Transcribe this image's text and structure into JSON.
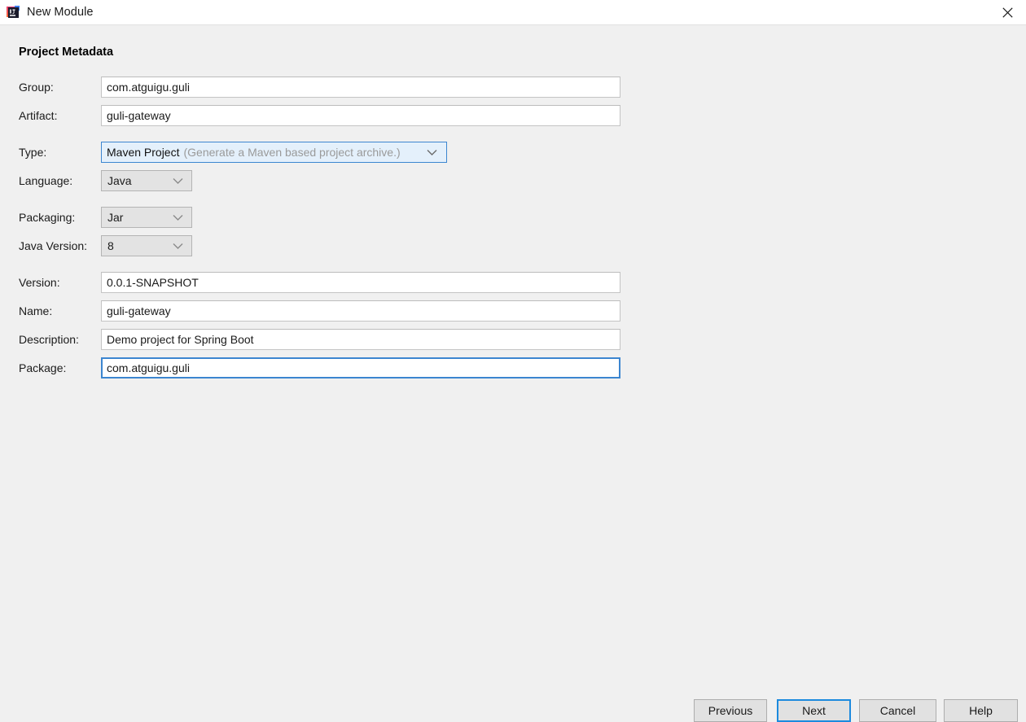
{
  "window": {
    "title": "New Module",
    "icon": "intellij-idea-icon",
    "close_label": "close-icon"
  },
  "section": {
    "title": "Project Metadata"
  },
  "fields": {
    "group": {
      "label": "Group:",
      "value": "com.atguigu.guli"
    },
    "artifact": {
      "label": "Artifact:",
      "value": "guli-gateway"
    },
    "type": {
      "label": "Type:",
      "value": "Maven Project",
      "hint": "(Generate a Maven based project archive.)"
    },
    "language": {
      "label": "Language:",
      "value": "Java"
    },
    "packaging": {
      "label": "Packaging:",
      "value": "Jar"
    },
    "java_version": {
      "label": "Java Version:",
      "value": "8"
    },
    "version": {
      "label": "Version:",
      "value": "0.0.1-SNAPSHOT"
    },
    "name": {
      "label": "Name:",
      "value": "guli-gateway"
    },
    "description": {
      "label": "Description:",
      "value": "Demo project for Spring Boot"
    },
    "package": {
      "label": "Package:",
      "value": "com.atguigu.guli"
    }
  },
  "buttons": {
    "previous": "Previous",
    "next": "Next",
    "cancel": "Cancel",
    "help": "Help"
  },
  "colors": {
    "focus_blue": "#1c8ade",
    "combo_focus_border": "#3c86d0",
    "combo_focus_bg": "#e4f0fb",
    "body_bg": "#f0f0f0",
    "titlebar_bg": "#ffffff"
  }
}
